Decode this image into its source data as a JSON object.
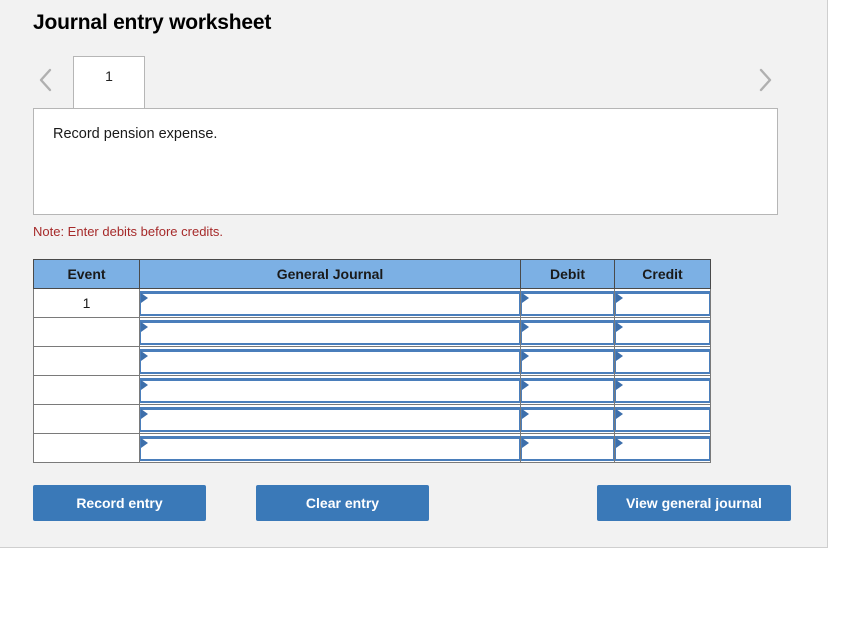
{
  "page": {
    "title": "Journal entry worksheet"
  },
  "colors": {
    "panel_bg": "#f2f2f2",
    "header_blue": "#7cb0e4",
    "button_blue": "#3a79b8",
    "note_red": "#a62a2a",
    "field_border_blue": "#4a7ebb"
  },
  "tabs": {
    "prev_label": "‹",
    "next_label": "›",
    "items": [
      {
        "label": "1",
        "selected": true
      }
    ]
  },
  "prompt": {
    "text": "Record pension expense."
  },
  "note": {
    "text": "Note: Enter debits before credits."
  },
  "table": {
    "columns": [
      "Event",
      "General Journal",
      "Debit",
      "Credit"
    ],
    "rows": [
      {
        "event": "1",
        "journal": "",
        "debit": "",
        "credit": ""
      },
      {
        "event": "",
        "journal": "",
        "debit": "",
        "credit": ""
      },
      {
        "event": "",
        "journal": "",
        "debit": "",
        "credit": ""
      },
      {
        "event": "",
        "journal": "",
        "debit": "",
        "credit": ""
      },
      {
        "event": "",
        "journal": "",
        "debit": "",
        "credit": ""
      },
      {
        "event": "",
        "journal": "",
        "debit": "",
        "credit": ""
      }
    ]
  },
  "actions": {
    "record": "Record entry",
    "clear": "Clear entry",
    "view": "View general journal"
  }
}
